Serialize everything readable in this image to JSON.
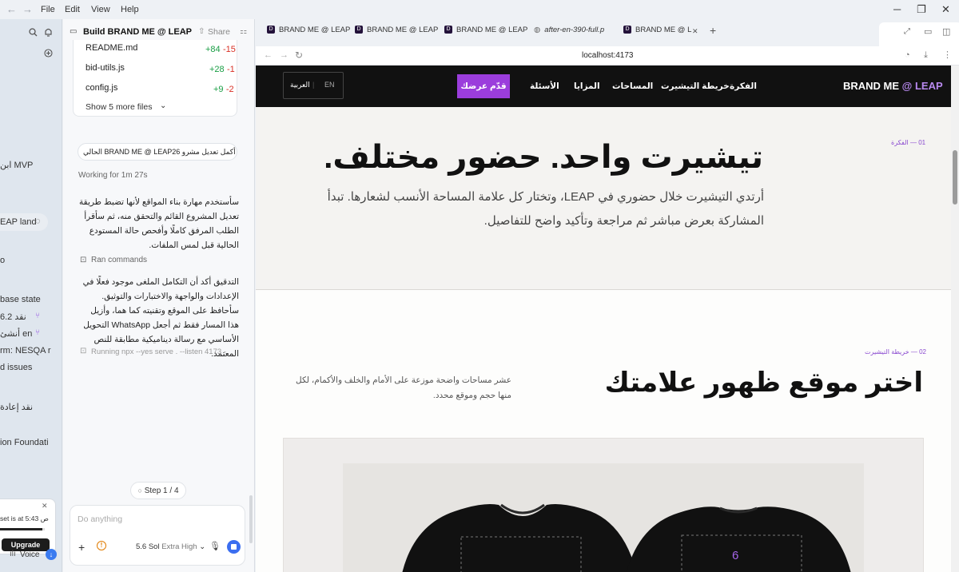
{
  "titlebar": {
    "menu": [
      "File",
      "Edit",
      "View",
      "Help"
    ],
    "back_arrow": "←",
    "forward_arrow": "→",
    "minimize": "─",
    "restore": "❐",
    "close": "✕"
  },
  "left_sidebar": {
    "items": [
      {
        "text": "ابن MVP"
      },
      {
        "text": "EAP land"
      },
      {
        "text": "o"
      },
      {
        "text": "base state"
      },
      {
        "text": "نقد 6.2"
      },
      {
        "text": "أنشئ en"
      },
      {
        "text": "rm: NESQA r"
      },
      {
        "text": "d issues"
      },
      {
        "text": "نقد إعادة"
      },
      {
        "text": "ion Foundati"
      }
    ],
    "notice_text": "set is at 5:43 ص",
    "upgrade_label": "Upgrade",
    "voice_label": "Voice"
  },
  "chat": {
    "title": "Build BRAND ME @ LEAP",
    "share_label": "Share",
    "more": "···",
    "files": [
      {
        "name": "README.md",
        "added": "+84",
        "removed": "-15"
      },
      {
        "name": "bid-utils.js",
        "added": "+28",
        "removed": "-1"
      },
      {
        "name": "config.js",
        "added": "+9",
        "removed": "-2"
      }
    ],
    "show_more": "Show 5 more files",
    "prompt_chip": "الحالي BRAND ME @ LEAP26 أكمل تعديل مشرو",
    "working": "Working for 1m 27s",
    "para1": "سأستخدم مهارة بناء المواقع لأنها تضبط طريقة تعديل المشروع القائم والتحقق منه، ثم سأقرأ الطلب المرفق كاملًا وأفحص حالة المستودع الحالية قبل لمس الملفات.",
    "ran_commands": "Ran commands",
    "para2": "التدقيق أكد أن التكامل الملغى موجود فعلًا في الإعدادات والواجهة والاختبارات والتوثيق. سأحافظ على الموقع وتقنيته كما هما، وأزيل هذا المسار فقط ثم أجعل WhatsApp التحويل الأساسي مع رسالة ديناميكية مطابقة للنص المعتمد.",
    "running": "Running npx --yes serve . --listen 4173 -",
    "step": "Step 1 / 4",
    "composer_placeholder": "Do anything",
    "model": "5.6 Sol",
    "effort": "Extra High"
  },
  "browser": {
    "tabs": [
      {
        "title": "BRAND ME @ LEAP"
      },
      {
        "title": "BRAND ME @ LEAP"
      },
      {
        "title": "BRAND ME @ LEAP"
      },
      {
        "title": "after-en-390-full.p"
      },
      {
        "title": "BRAND ME @ L"
      }
    ],
    "new_tab": "+",
    "url": "localhost:4173"
  },
  "site": {
    "brand_main": "BRAND ME ",
    "brand_accent": "@ LEAP",
    "nav": [
      "الفكرة",
      "خريطة التيشيرت",
      "المساحات",
      "المزايا",
      "الأسئلة"
    ],
    "cta": "قدّم عرضك",
    "lang_en": "EN",
    "lang_sep": "|",
    "lang_ar": "العربية",
    "section1_label": "01 — الفكرة",
    "hero_title": "تيشيرت واحد. حضور مختلف.",
    "hero_sub": "أرتدي التيشيرت خلال حضوري في LEAP، وتختار كل علامة المساحة الأنسب لشعارها. تبدأ المشاركة بعرض مباشر ثم مراجعة وتأكيد واضح للتفاصيل.",
    "section2_label": "02 — خريطة التيشيرت",
    "section2_title": "اختر موقع ظهور علامتك",
    "section2_desc": "عشر مساحات واضحة موزعة على الأمام والخلف والأكمام، لكل منها حجم وموقع محدد.",
    "shirt_number": "6"
  },
  "colors": {
    "accent_purple": "#9b3ddc",
    "site_nav_bg": "#111111",
    "diff_add": "#1a9e45",
    "diff_del": "#d93025"
  }
}
